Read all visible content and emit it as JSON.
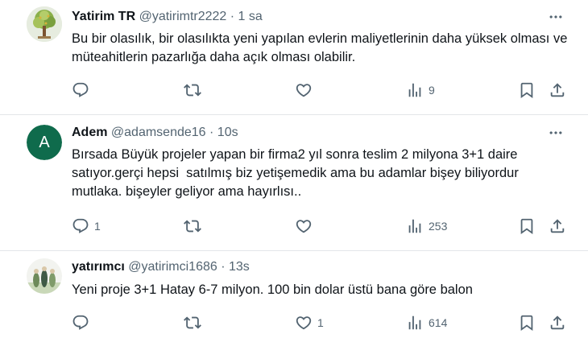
{
  "tweets": [
    {
      "name": "Yatirim TR",
      "handle": "@yatirimtr2222",
      "time": "· 1 sa",
      "text": "Bu bir olasılık, bir olasılıkta yeni yapılan evlerin maliyetlerinin daha yüksek olması ve müteahitlerin pazarlığa daha açık olması olabilir.",
      "avatar": "tree-avatar",
      "reply_count": "",
      "like_count": "",
      "views": "9"
    },
    {
      "name": "Adem",
      "handle": "@adamsende16",
      "time": "· 10s",
      "text": "Bırsada Büyük projeler yapan bir firma2 yıl sonra teslim 2 milyona 3+1 daire satıyor.gerçi hepsi  satılmış biz yetişemedik ama bu adamlar bişey biliyordur mutlaka. bişeyler geliyor ama hayırlısı..",
      "avatar_letter": "A",
      "avatar_color": "#0f6b4c",
      "reply_count": "1",
      "like_count": "",
      "views": "253"
    },
    {
      "name": "yatırımcı",
      "handle": "@yatirimci1686",
      "time": "· 13s",
      "text": "Yeni proje 3+1 Hatay 6-7 milyon. 100 bin dolar üstü bana göre balon",
      "avatar": "photo-avatar",
      "reply_count": "",
      "like_count": "1",
      "views": "614"
    }
  ],
  "icons": {
    "reply": "reply-icon",
    "retweet": "retweet-icon",
    "like": "like-icon",
    "views": "views-icon",
    "bookmark": "bookmark-icon",
    "share": "share-icon",
    "more": "more-icon"
  },
  "colors": {
    "text": "#0f1419",
    "secondary": "#536471",
    "divider": "#e3e6e9"
  }
}
